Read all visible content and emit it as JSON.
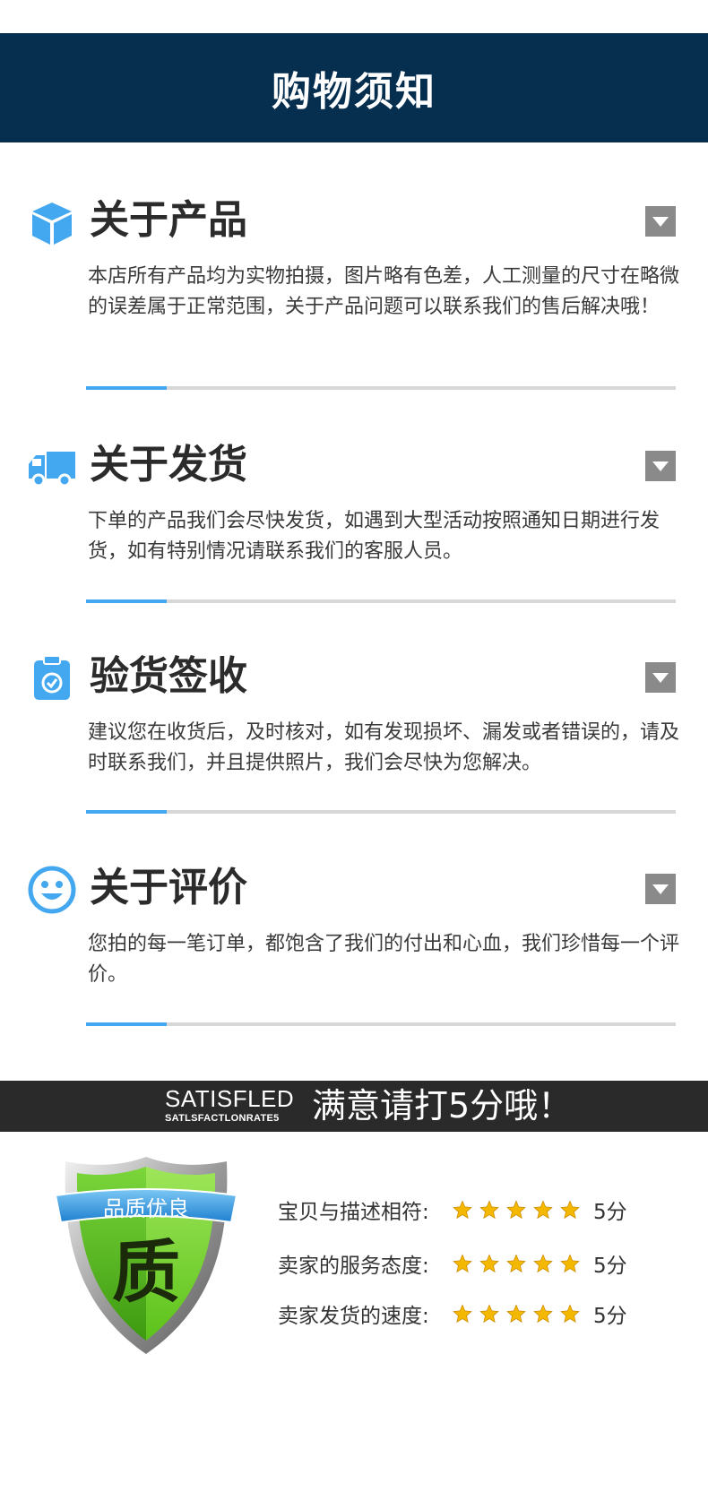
{
  "header": {
    "title": "购物须知"
  },
  "sections": [
    {
      "icon": "box-icon",
      "title": "关于产品",
      "body": "本店所有产品均为实物拍摄，图片略有色差，人工测量的尺寸在略微的误差属于正常范围，关于产品问题可以联系我们的售后解决哦！"
    },
    {
      "icon": "truck-icon",
      "title": "关于发货",
      "body": "下单的产品我们会尽快发货，如遇到大型活动按照通知日期进行发货，如有特别情况请联系我们的客服人员。"
    },
    {
      "icon": "clipboard-check-icon",
      "title": "验货签收",
      "body": "建议您在收货后，及时核对，如有发现损坏、漏发或者错误的，请及时联系我们，并且提供照片，我们会尽快为您解决。"
    },
    {
      "icon": "smiley-icon",
      "title": "关于评价",
      "body": "您拍的每一笔订单，都饱含了我们的付出和心血，我们珍惜每一个评价。"
    }
  ],
  "banner": {
    "en_main": "SATISFLED",
    "en_sub": "SATLSFACTLONRATE5",
    "cn": "满意请打5分哦！"
  },
  "badge": {
    "ribbon_text": "品质优良",
    "center_char": "质"
  },
  "ratings": [
    {
      "label": "宝贝与描述相符:",
      "stars": 5,
      "score": "5分"
    },
    {
      "label": "卖家的服务态度:",
      "stars": 5,
      "score": "5分"
    },
    {
      "label": "卖家发货的速度:",
      "stars": 5,
      "score": "5分"
    }
  ],
  "colors": {
    "header_bg": "#062e4f",
    "accent_blue": "#44a8f0",
    "banner_bg": "#2a2a2a",
    "star": "#f5b800",
    "badge_green": "#5cc21a"
  }
}
